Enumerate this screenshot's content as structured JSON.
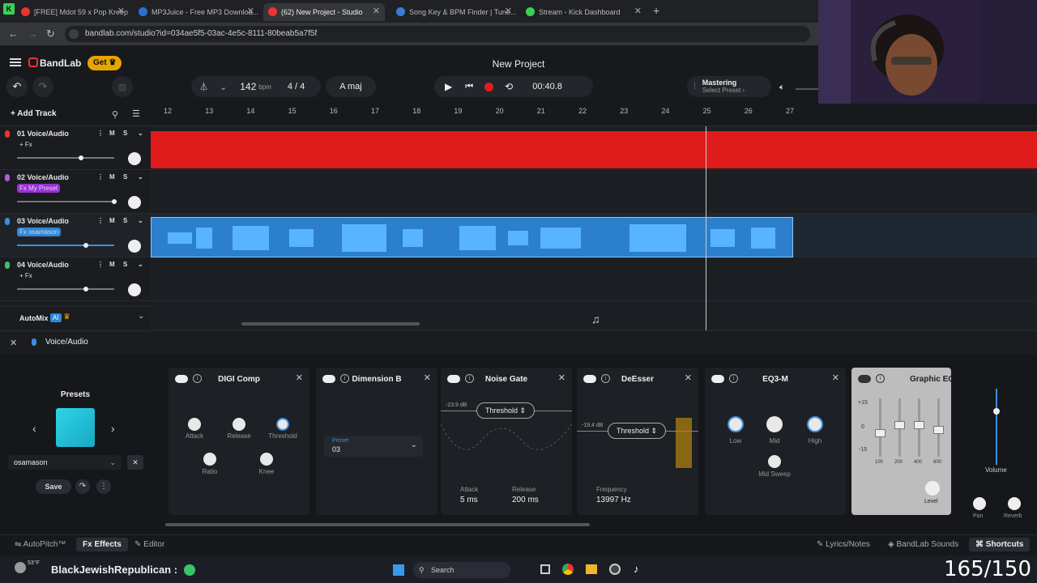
{
  "browser": {
    "tabs": [
      {
        "label": "[FREE] Mdot 59 x Pop Kreep Je..."
      },
      {
        "label": "MP3Juice - Free MP3 Downloa..."
      },
      {
        "label": "(62) New Project - Studio"
      },
      {
        "label": "Song Key & BPM Finder | Tune..."
      },
      {
        "label": "Stream - Kick Dashboard"
      }
    ],
    "url": "bandlab.com/studio?id=034ae5f5-03ac-4e5c-8111-80beab5a7f5f"
  },
  "app": {
    "brand": "BandLab",
    "get_label": "Get",
    "project_title": "New Project",
    "tempo": "142",
    "tempo_unit": "bpm",
    "time_sig": "4 / 4",
    "key": "A maj",
    "time": "00:40.8",
    "mastering_label": "Mastering",
    "mastering_sub": "Select Preset",
    "add_track": "Add Track",
    "automix_label": "AutoMix",
    "automix_ai": "AI"
  },
  "ruler": [
    "12",
    "13",
    "14",
    "15",
    "16",
    "17",
    "18",
    "19",
    "20",
    "21",
    "22",
    "23",
    "24",
    "25",
    "26",
    "27"
  ],
  "tracks": [
    {
      "name": "01  Voice/Audio",
      "fx": "+ Fx",
      "mute": "M",
      "solo": "S"
    },
    {
      "name": "02  Voice/Audio",
      "fx": "Fx  My Preset",
      "mute": "M",
      "solo": "S"
    },
    {
      "name": "03  Voice/Audio",
      "fx": "Fx  osamason",
      "mute": "M",
      "solo": "S"
    },
    {
      "name": "04  Voice/Audio",
      "fx": "+ Fx",
      "mute": "M",
      "solo": "S"
    }
  ],
  "fx": {
    "track_title": "Voice/Audio",
    "presets_label": "Presets",
    "preset_value": "osamason",
    "save_label": "Save",
    "cards": {
      "digi": {
        "title": "DIGI Comp",
        "attack": "Attack",
        "release": "Release",
        "threshold": "Threshold",
        "ratio": "Ratio",
        "knee": "Knee"
      },
      "dim": {
        "title": "Dimension B",
        "preset_label": "Preset",
        "preset_value": "03"
      },
      "gate": {
        "title": "Noise Gate",
        "param": "Threshold",
        "db": "-23.9 dB",
        "attack_label": "Attack",
        "attack_value": "5 ms",
        "release_label": "Release",
        "release_value": "200 ms"
      },
      "deesser": {
        "title": "DeEsser",
        "param": "Threshold",
        "db": "-19.4 dB",
        "freq_label": "Frequency",
        "freq_value": "13997 Hz"
      },
      "eq": {
        "title": "EQ3-M",
        "low": "Low",
        "mid": "Mid",
        "high": "High",
        "sweep": "Mid Sweep"
      },
      "geq": {
        "title": "Graphic EQ",
        "scale": [
          "+15",
          "0",
          "-15"
        ],
        "bands": [
          "100",
          "200",
          "400",
          "800"
        ],
        "level": "Level"
      }
    },
    "volume_label": "Volume",
    "pan_label": "Pan",
    "reverb_label": "Reverb"
  },
  "bottom": {
    "autopitch": "AutoPitch™",
    "effects": "Effects",
    "editor": "Editor",
    "lyrics": "Lyrics/Notes",
    "sounds": "BandLab Sounds",
    "shortcuts": "Shortcuts"
  },
  "taskbar": {
    "weather": "53°F",
    "stream_text": "BlackJewishRepublican :",
    "search": "Search",
    "counter": "165/150"
  },
  "colors": {
    "track1": "#e11d1d",
    "track3": "#2f86d6",
    "accent": "#e8a400",
    "brand": "#e8e8e8"
  }
}
